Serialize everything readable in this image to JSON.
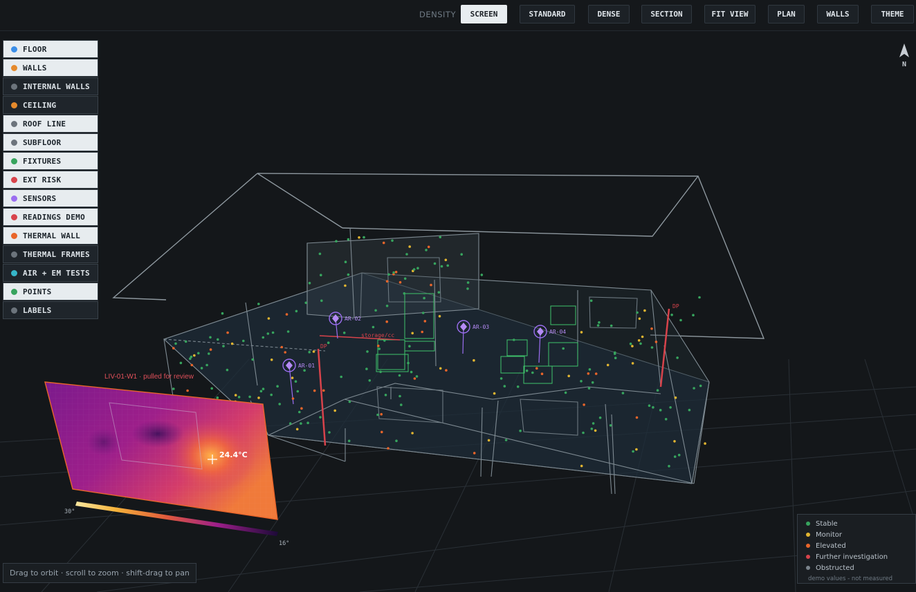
{
  "toolbar": {
    "density_label": "DENSITY",
    "buttons": [
      {
        "label": "SCREEN",
        "active": true
      },
      {
        "label": "STANDARD",
        "active": false
      },
      {
        "label": "DENSE",
        "active": false
      },
      {
        "label": "SECTION",
        "active": false
      },
      {
        "label": "FIT VIEW",
        "active": false
      },
      {
        "label": "PLAN",
        "active": false
      },
      {
        "label": "WALLS",
        "active": false
      },
      {
        "label": "THEME",
        "active": false
      }
    ]
  },
  "layers": [
    {
      "label": "FLOOR",
      "color": "#3b8ee8",
      "on": true
    },
    {
      "label": "WALLS",
      "color": "#e58a2c",
      "on": true
    },
    {
      "label": "INTERNAL WALLS",
      "color": "#6c747c",
      "on": false
    },
    {
      "label": "CEILING",
      "color": "#e58a2c",
      "on": false
    },
    {
      "label": "ROOF LINE",
      "color": "#6c747c",
      "on": true
    },
    {
      "label": "SUBFLOOR",
      "color": "#6c747c",
      "on": true
    },
    {
      "label": "FIXTURES",
      "color": "#37a45e",
      "on": true
    },
    {
      "label": "EXT RISK",
      "color": "#d8434b",
      "on": true
    },
    {
      "label": "SENSORS",
      "color": "#9b6ef0",
      "on": true
    },
    {
      "label": "READINGS DEMO",
      "color": "#d8434b",
      "on": true
    },
    {
      "label": "THERMAL WALL",
      "color": "#e9652a",
      "on": true
    },
    {
      "label": "THERMAL FRAMES",
      "color": "#6c747c",
      "on": false
    },
    {
      "label": "AIR + EM TESTS",
      "color": "#36b6c9",
      "on": false
    },
    {
      "label": "POINTS",
      "color": "#37a45e",
      "on": true
    },
    {
      "label": "LABELS",
      "color": "#6c747c",
      "on": false
    }
  ],
  "compass": {
    "label": "N"
  },
  "scene": {
    "thermal_label": "LIV-01-W1 · pulled for review",
    "thermal_reading": "24.4°C",
    "scale_max": "30°",
    "scale_min": "16°",
    "sensors": [
      "AR-01",
      "AR-02",
      "AR-03",
      "AR-04"
    ],
    "dp_label": "DP",
    "storage_label": "storage/cc"
  },
  "hint": "Drag to orbit · scroll to zoom · shift-drag to pan",
  "legend": {
    "items": [
      {
        "label": "Stable",
        "color": "#37a45e"
      },
      {
        "label": "Monitor",
        "color": "#e2b531"
      },
      {
        "label": "Elevated",
        "color": "#e9652a"
      },
      {
        "label": "Further investigation",
        "color": "#d8434b"
      },
      {
        "label": "Obstructed",
        "color": "#7b848c"
      }
    ],
    "note": "demo values - not measured"
  },
  "colors": {
    "wire": "#7e8a92",
    "grid": "#2a3036",
    "stable": "#37a45e",
    "monitor": "#e2b531",
    "elevated": "#e9652a",
    "sensor": "#9b6ef0",
    "risk": "#d8434b",
    "fixture": "#3fc46b"
  }
}
